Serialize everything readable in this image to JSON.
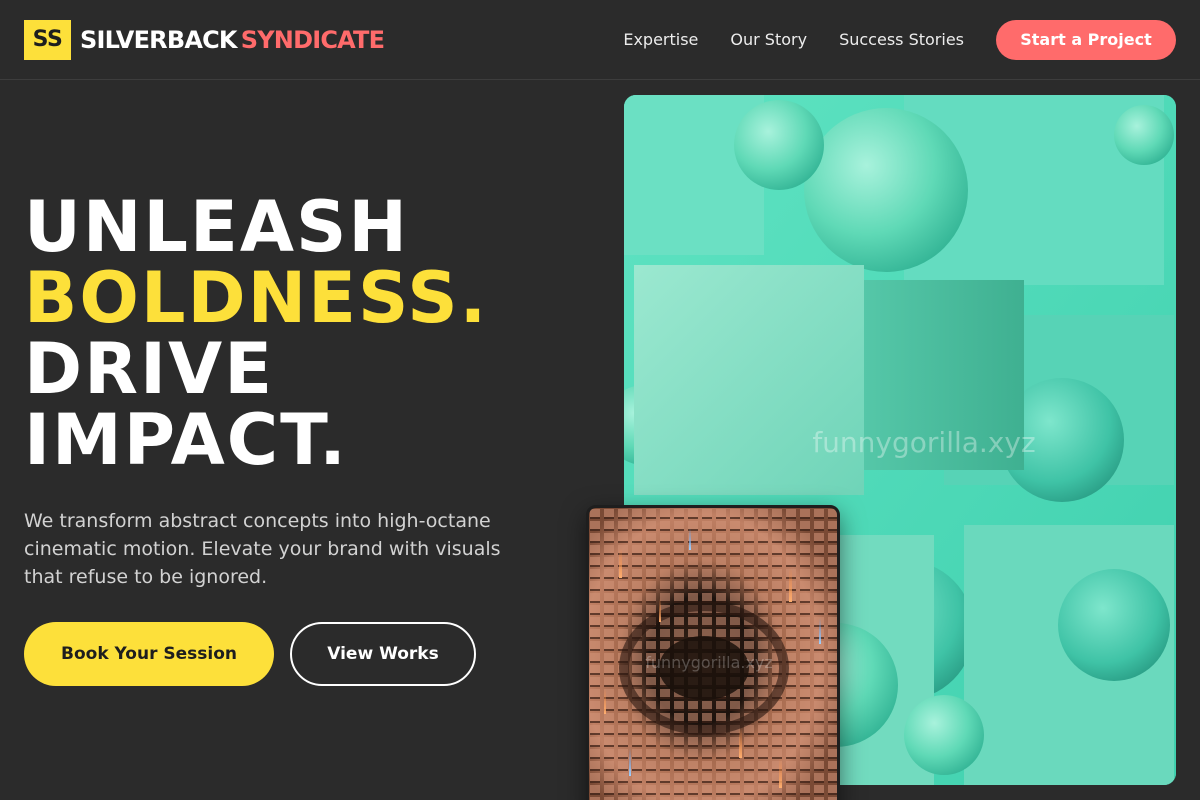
{
  "brand": {
    "badge": "SS",
    "name_part1": "SILVERBACK",
    "name_part2": "SYNDICATE",
    "accent_yellow": "#fde03a",
    "accent_coral": "#ff6b6b",
    "background": "#2b2b2b"
  },
  "nav": {
    "links": [
      "Expertise",
      "Our Story",
      "Success Stories"
    ],
    "cta": "Start a Project"
  },
  "hero": {
    "line1": "UNLEASH",
    "line2": "BOLDNESS.",
    "line3": "DRIVE",
    "line4": "IMPACT.",
    "subtitle": "We transform abstract concepts into high-octane cinematic motion. Elevate your brand with visuals that refuse to be ignored.",
    "primary_button": "Book Your Session",
    "secondary_button": "View Works"
  },
  "images": {
    "main_watermark": "funnygorilla.xyz",
    "small_watermark": "funnygorilla.xyz"
  }
}
